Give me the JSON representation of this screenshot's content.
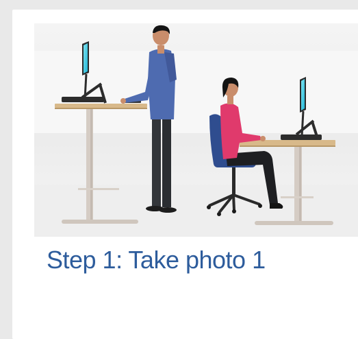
{
  "card": {
    "image_alt": "standing and seated desk workers",
    "step_title": "Step 1: Take photo 1"
  },
  "colors": {
    "page_background": "#e9e9e9",
    "card_background": "#ffffff",
    "title_color": "#2d5c9c",
    "desk_top": "#d8b98a",
    "desk_frame": "#d5ccc4",
    "shirt_blue": "#4e6bb0",
    "shirt_pink": "#e03a6c",
    "chair_blue": "#2f4d8f",
    "monitor_screen": "#37c9e0"
  }
}
